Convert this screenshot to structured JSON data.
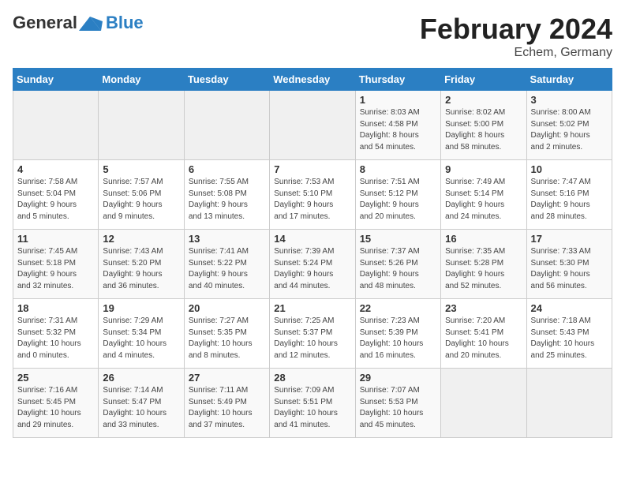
{
  "header": {
    "logo_line1": "General",
    "logo_line2": "Blue",
    "month": "February 2024",
    "location": "Echem, Germany"
  },
  "weekdays": [
    "Sunday",
    "Monday",
    "Tuesday",
    "Wednesday",
    "Thursday",
    "Friday",
    "Saturday"
  ],
  "weeks": [
    [
      {
        "day": "",
        "info": ""
      },
      {
        "day": "",
        "info": ""
      },
      {
        "day": "",
        "info": ""
      },
      {
        "day": "",
        "info": ""
      },
      {
        "day": "1",
        "info": "Sunrise: 8:03 AM\nSunset: 4:58 PM\nDaylight: 8 hours\nand 54 minutes."
      },
      {
        "day": "2",
        "info": "Sunrise: 8:02 AM\nSunset: 5:00 PM\nDaylight: 8 hours\nand 58 minutes."
      },
      {
        "day": "3",
        "info": "Sunrise: 8:00 AM\nSunset: 5:02 PM\nDaylight: 9 hours\nand 2 minutes."
      }
    ],
    [
      {
        "day": "4",
        "info": "Sunrise: 7:58 AM\nSunset: 5:04 PM\nDaylight: 9 hours\nand 5 minutes."
      },
      {
        "day": "5",
        "info": "Sunrise: 7:57 AM\nSunset: 5:06 PM\nDaylight: 9 hours\nand 9 minutes."
      },
      {
        "day": "6",
        "info": "Sunrise: 7:55 AM\nSunset: 5:08 PM\nDaylight: 9 hours\nand 13 minutes."
      },
      {
        "day": "7",
        "info": "Sunrise: 7:53 AM\nSunset: 5:10 PM\nDaylight: 9 hours\nand 17 minutes."
      },
      {
        "day": "8",
        "info": "Sunrise: 7:51 AM\nSunset: 5:12 PM\nDaylight: 9 hours\nand 20 minutes."
      },
      {
        "day": "9",
        "info": "Sunrise: 7:49 AM\nSunset: 5:14 PM\nDaylight: 9 hours\nand 24 minutes."
      },
      {
        "day": "10",
        "info": "Sunrise: 7:47 AM\nSunset: 5:16 PM\nDaylight: 9 hours\nand 28 minutes."
      }
    ],
    [
      {
        "day": "11",
        "info": "Sunrise: 7:45 AM\nSunset: 5:18 PM\nDaylight: 9 hours\nand 32 minutes."
      },
      {
        "day": "12",
        "info": "Sunrise: 7:43 AM\nSunset: 5:20 PM\nDaylight: 9 hours\nand 36 minutes."
      },
      {
        "day": "13",
        "info": "Sunrise: 7:41 AM\nSunset: 5:22 PM\nDaylight: 9 hours\nand 40 minutes."
      },
      {
        "day": "14",
        "info": "Sunrise: 7:39 AM\nSunset: 5:24 PM\nDaylight: 9 hours\nand 44 minutes."
      },
      {
        "day": "15",
        "info": "Sunrise: 7:37 AM\nSunset: 5:26 PM\nDaylight: 9 hours\nand 48 minutes."
      },
      {
        "day": "16",
        "info": "Sunrise: 7:35 AM\nSunset: 5:28 PM\nDaylight: 9 hours\nand 52 minutes."
      },
      {
        "day": "17",
        "info": "Sunrise: 7:33 AM\nSunset: 5:30 PM\nDaylight: 9 hours\nand 56 minutes."
      }
    ],
    [
      {
        "day": "18",
        "info": "Sunrise: 7:31 AM\nSunset: 5:32 PM\nDaylight: 10 hours\nand 0 minutes."
      },
      {
        "day": "19",
        "info": "Sunrise: 7:29 AM\nSunset: 5:34 PM\nDaylight: 10 hours\nand 4 minutes."
      },
      {
        "day": "20",
        "info": "Sunrise: 7:27 AM\nSunset: 5:35 PM\nDaylight: 10 hours\nand 8 minutes."
      },
      {
        "day": "21",
        "info": "Sunrise: 7:25 AM\nSunset: 5:37 PM\nDaylight: 10 hours\nand 12 minutes."
      },
      {
        "day": "22",
        "info": "Sunrise: 7:23 AM\nSunset: 5:39 PM\nDaylight: 10 hours\nand 16 minutes."
      },
      {
        "day": "23",
        "info": "Sunrise: 7:20 AM\nSunset: 5:41 PM\nDaylight: 10 hours\nand 20 minutes."
      },
      {
        "day": "24",
        "info": "Sunrise: 7:18 AM\nSunset: 5:43 PM\nDaylight: 10 hours\nand 25 minutes."
      }
    ],
    [
      {
        "day": "25",
        "info": "Sunrise: 7:16 AM\nSunset: 5:45 PM\nDaylight: 10 hours\nand 29 minutes."
      },
      {
        "day": "26",
        "info": "Sunrise: 7:14 AM\nSunset: 5:47 PM\nDaylight: 10 hours\nand 33 minutes."
      },
      {
        "day": "27",
        "info": "Sunrise: 7:11 AM\nSunset: 5:49 PM\nDaylight: 10 hours\nand 37 minutes."
      },
      {
        "day": "28",
        "info": "Sunrise: 7:09 AM\nSunset: 5:51 PM\nDaylight: 10 hours\nand 41 minutes."
      },
      {
        "day": "29",
        "info": "Sunrise: 7:07 AM\nSunset: 5:53 PM\nDaylight: 10 hours\nand 45 minutes."
      },
      {
        "day": "",
        "info": ""
      },
      {
        "day": "",
        "info": ""
      }
    ]
  ]
}
